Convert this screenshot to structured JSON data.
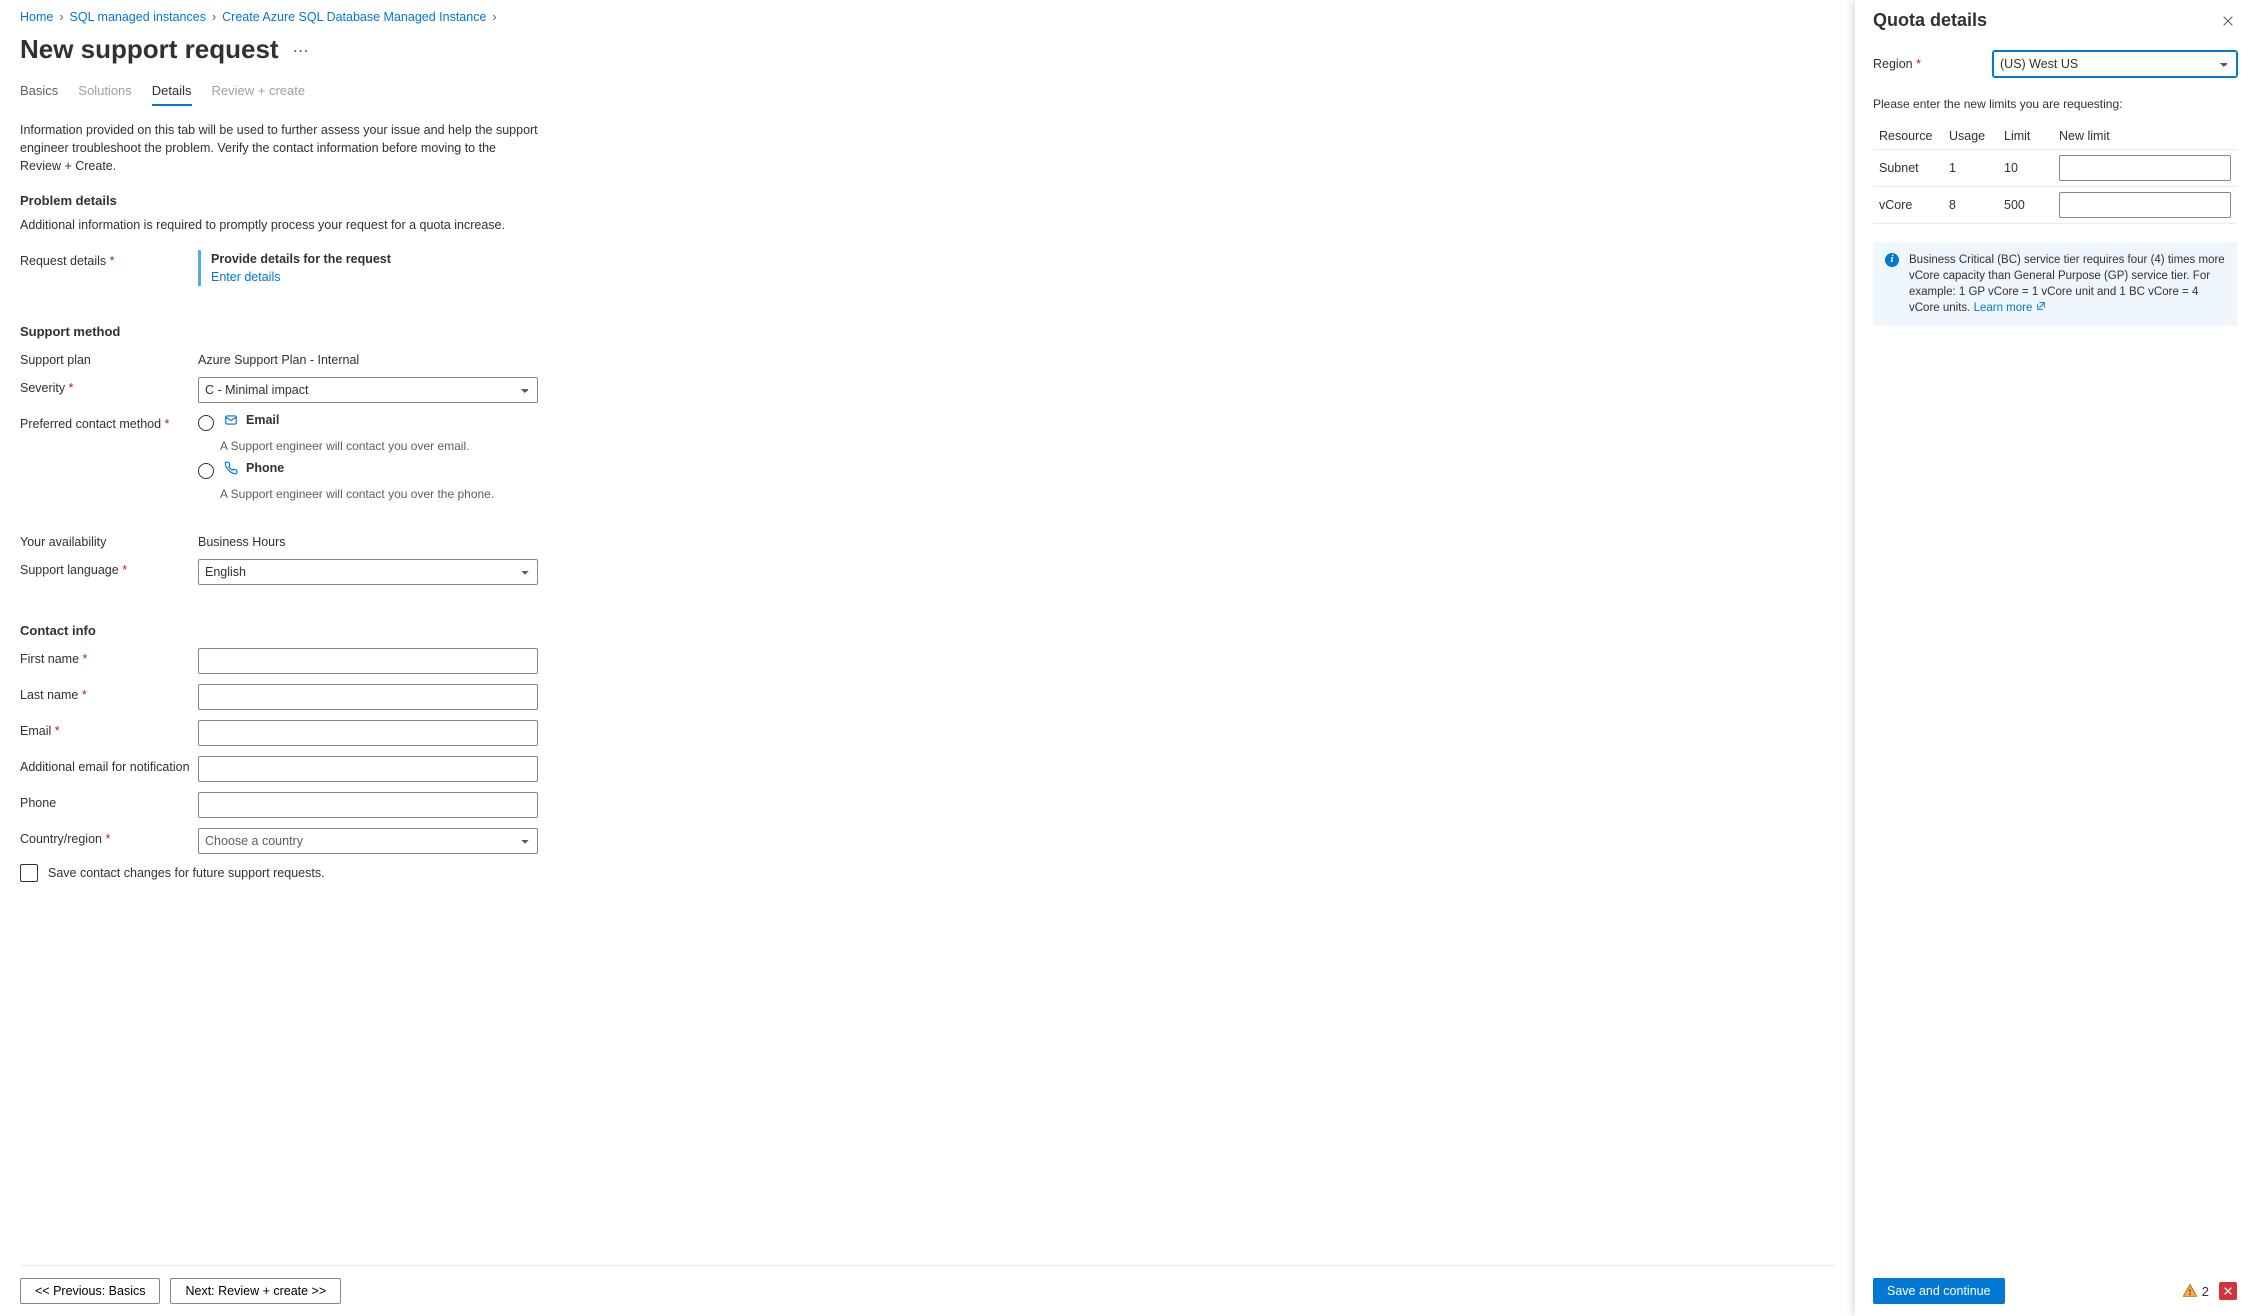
{
  "breadcrumb": [
    {
      "label": "Home"
    },
    {
      "label": "SQL managed instances"
    },
    {
      "label": "Create Azure SQL Database Managed Instance"
    }
  ],
  "page_title": "New support request",
  "tabs": [
    {
      "id": "basics",
      "label": "Basics"
    },
    {
      "id": "solutions",
      "label": "Solutions"
    },
    {
      "id": "details",
      "label": "Details"
    },
    {
      "id": "review",
      "label": "Review + create"
    }
  ],
  "intro_text": "Information provided on this tab will be used to further assess your issue and help the support engineer troubleshoot the problem. Verify the contact information before moving to the Review + Create.",
  "sections": {
    "problem_details": {
      "heading": "Problem details",
      "sub": "Additional information is required to promptly process your request for a quota increase.",
      "request_details_label": "Request details",
      "provide_title": "Provide details for the request",
      "enter_details": "Enter details"
    },
    "support_method": {
      "heading": "Support method",
      "support_plan_label": "Support plan",
      "support_plan_value": "Azure Support Plan - Internal",
      "severity_label": "Severity",
      "severity_value": "C - Minimal impact",
      "contact_method_label": "Preferred contact method",
      "email": {
        "label": "Email",
        "desc": "A Support engineer will contact you over email."
      },
      "phone": {
        "label": "Phone",
        "desc": "A Support engineer will contact you over the phone."
      },
      "availability_label": "Your availability",
      "availability_value": "Business Hours",
      "language_label": "Support language",
      "language_value": "English"
    },
    "contact_info": {
      "heading": "Contact info",
      "first_name": "First name",
      "last_name": "Last name",
      "email": "Email",
      "additional_email": "Additional email for notification",
      "phone": "Phone",
      "country": "Country/region",
      "country_placeholder": "Choose a country",
      "save_checkbox": "Save contact changes for future support requests."
    }
  },
  "footer": {
    "previous": "<< Previous: Basics",
    "next": "Next: Review + create >>"
  },
  "panel": {
    "title": "Quota details",
    "region_label": "Region",
    "region_value": "(US) West US",
    "instruction": "Please enter the new limits you are requesting:",
    "columns": {
      "resource": "Resource",
      "usage": "Usage",
      "limit": "Limit",
      "newlimit": "New limit"
    },
    "rows": [
      {
        "resource": "Subnet",
        "usage": "1",
        "limit": "10"
      },
      {
        "resource": "vCore",
        "usage": "8",
        "limit": "500"
      }
    ],
    "info": "Business Critical (BC) service tier requires four (4) times more vCore capacity than General Purpose (GP) service tier. For example: 1 GP vCore = 1 vCore unit and 1 BC vCore = 4 vCore units.",
    "learn_more": "Learn more",
    "save_btn": "Save and continue",
    "warn_count": "2"
  }
}
